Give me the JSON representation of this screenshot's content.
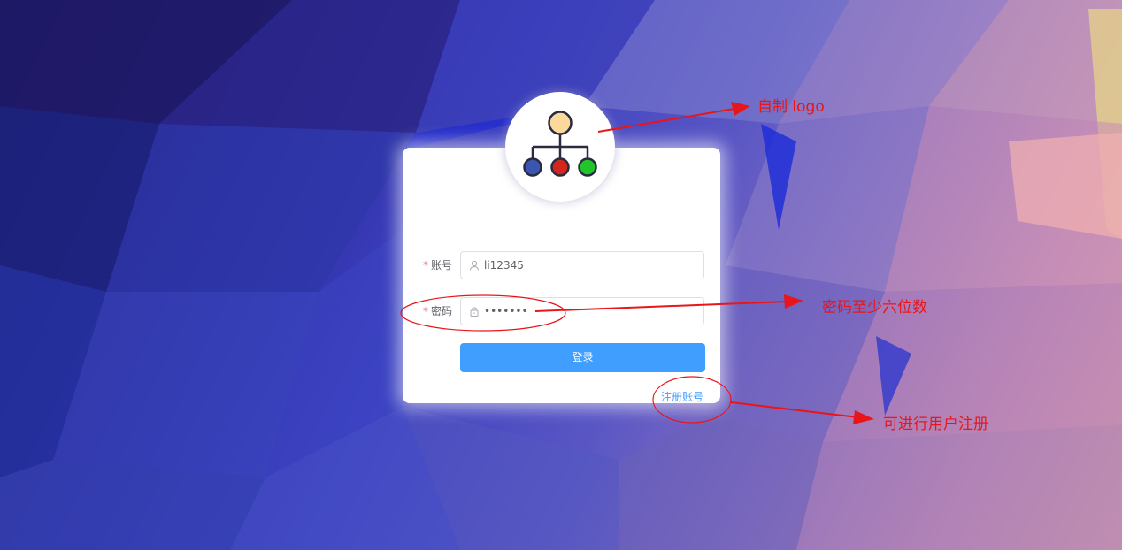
{
  "form": {
    "account_label": "账号",
    "account_value": "li12345",
    "password_label": "密码",
    "password_value": "•••••••",
    "required_mark": "*",
    "login_button": "登录",
    "register_link": "注册账号"
  },
  "annotations": {
    "logo_note": "自制 logo",
    "password_note": "密码至少六位数",
    "register_note": "可进行用户注册"
  },
  "colors": {
    "primary": "#409eff",
    "required": "#f56c6c",
    "annotation": "#e8161b"
  },
  "icons": [
    "user-icon",
    "lock-icon",
    "org-chart-logo-icon"
  ]
}
